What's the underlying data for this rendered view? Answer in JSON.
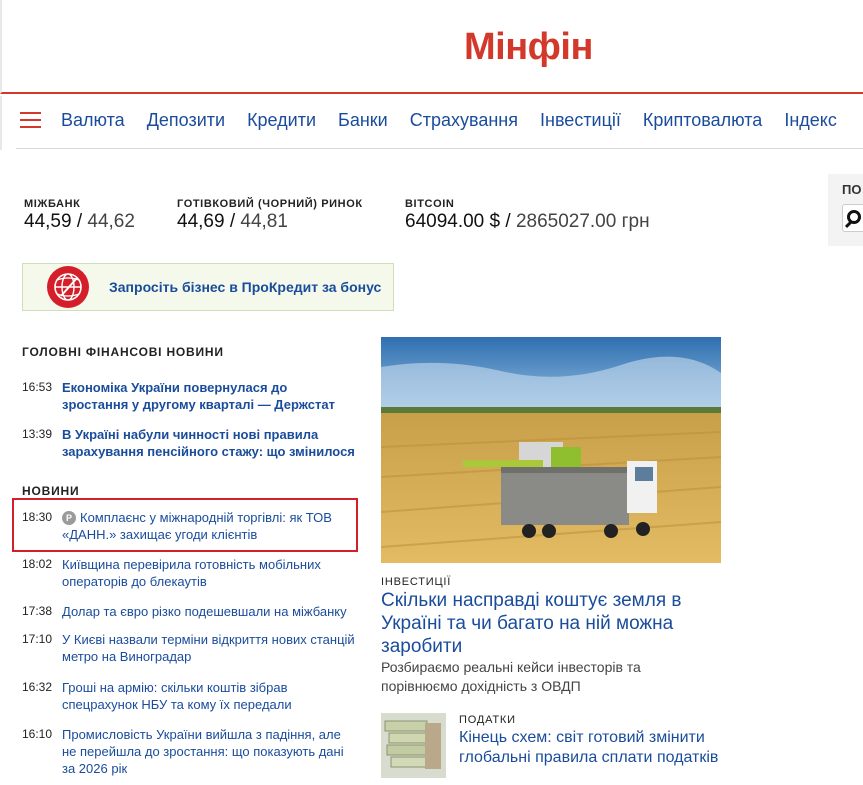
{
  "header": {
    "logo": "Мінфін"
  },
  "nav": {
    "menu_icon": "hamburger-menu-icon",
    "items": [
      "Валюта",
      "Депозити",
      "Кредити",
      "Банки",
      "Страхування",
      "Інвестиції",
      "Криптовалюта",
      "Індекс"
    ]
  },
  "rates": [
    {
      "label": "МІЖБАНК",
      "value1": "44,59",
      "value2": "44,62"
    },
    {
      "label": "ГОТІВКОВИЙ (ЧОРНИЙ) РИНОК",
      "value1": "44,69",
      "value2": "44,81"
    },
    {
      "label": "BITCOIN",
      "value1": "64094.00 $",
      "value2": "2865027.00 грн"
    }
  ],
  "search": {
    "label": "ПО",
    "icon": "search-icon"
  },
  "promo": {
    "text": "Запросіть бізнес в ПроКредит за бонус",
    "icon": "procredit-logo-icon"
  },
  "main_news": {
    "title": "ГОЛОВНІ ФІНАНСОВІ НОВИНИ",
    "items": [
      {
        "time": "16:53",
        "title": "Економіка України повернулася до зростання у другому кварталі — Держстат"
      },
      {
        "time": "13:39",
        "title": "В Україні набули чинності нові правила зарахування пенсійного стажу: що змінилося"
      }
    ]
  },
  "news": {
    "title": "НОВИНИ",
    "sponsored_badge": "P",
    "items": [
      {
        "time": "18:30",
        "title": "Комплаєнс у міжнародній торгівлі: як ТОВ «ДАНН.» захищає угоди клієнтів"
      },
      {
        "time": "18:02",
        "title": "Київщина перевірила готовність мобільних операторів до блекаутів"
      },
      {
        "time": "17:38",
        "title": "Долар та євро різко подешевшали на міжбанку"
      },
      {
        "time": "17:10",
        "title": "У Києві назвали терміни відкриття нових станцій метро на Виноградар"
      },
      {
        "time": "16:32",
        "title": "Гроші на армію: скільки коштів зібрав спецрахунок НБУ та кому їх передали"
      },
      {
        "time": "16:10",
        "title": "Промисловість України вийшла з падіння, але не перейшла до зростання: що показують дані за 2026 рік"
      }
    ]
  },
  "featured": {
    "category": "ІНВЕСТИЦІЇ",
    "title": "Скільки насправді коштує земля в Україні та чи багато на ній можна заробити",
    "subtitle": "Розбираємо реальні кейси інвесторів та порівнюємо дохідність з ОВДП"
  },
  "secondary": {
    "category": "ПОДАТКИ",
    "title": "Кінець схем: світ готовий змінити глобальні правила сплати податків"
  }
}
